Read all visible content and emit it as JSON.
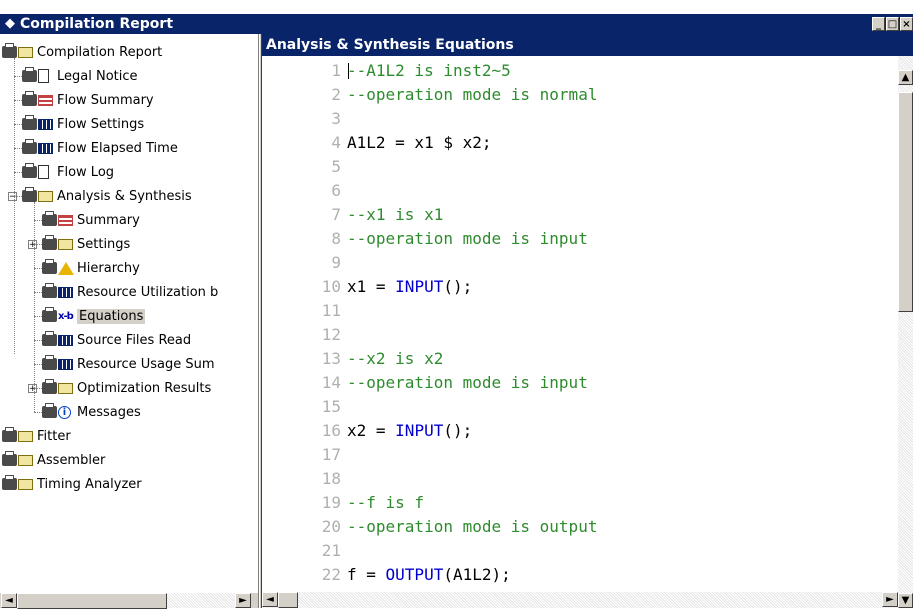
{
  "window": {
    "title": "Compilation Report",
    "buttons": {
      "minimize": "_",
      "maximize": "□",
      "close": "×"
    }
  },
  "tree": [
    {
      "id": "compilation-report",
      "label": "Compilation Report",
      "icon": "folder",
      "level": 0,
      "expander": ""
    },
    {
      "id": "legal-notice",
      "label": "Legal Notice",
      "icon": "document",
      "level": 1,
      "expander": ""
    },
    {
      "id": "flow-summary",
      "label": "Flow Summary",
      "icon": "table-red",
      "level": 1,
      "expander": ""
    },
    {
      "id": "flow-settings",
      "label": "Flow Settings",
      "icon": "table",
      "level": 1,
      "expander": ""
    },
    {
      "id": "flow-elapsed-time",
      "label": "Flow Elapsed Time",
      "icon": "table",
      "level": 1,
      "expander": ""
    },
    {
      "id": "flow-log",
      "label": "Flow Log",
      "icon": "document",
      "level": 1,
      "expander": ""
    },
    {
      "id": "analysis-synthesis",
      "label": "Analysis & Synthesis",
      "icon": "folder",
      "level": 1,
      "expander": "−"
    },
    {
      "id": "summary",
      "label": "Summary",
      "icon": "table-red",
      "level": 2,
      "expander": ""
    },
    {
      "id": "settings",
      "label": "Settings",
      "icon": "folder",
      "level": 2,
      "expander": "+"
    },
    {
      "id": "hierarchy",
      "label": "Hierarchy",
      "icon": "warning",
      "level": 2,
      "expander": ""
    },
    {
      "id": "resource-utilization",
      "label": "Resource Utilization b",
      "icon": "table",
      "level": 2,
      "expander": ""
    },
    {
      "id": "equations",
      "label": "Equations",
      "icon": "equations",
      "level": 2,
      "expander": "",
      "selected": true
    },
    {
      "id": "source-files-read",
      "label": "Source Files Read",
      "icon": "table",
      "level": 2,
      "expander": ""
    },
    {
      "id": "resource-usage-summary",
      "label": "Resource Usage Sum",
      "icon": "table",
      "level": 2,
      "expander": ""
    },
    {
      "id": "optimization-results",
      "label": "Optimization Results",
      "icon": "folder",
      "level": 2,
      "expander": "+"
    },
    {
      "id": "messages",
      "label": "Messages",
      "icon": "info",
      "level": 2,
      "expander": ""
    },
    {
      "id": "fitter",
      "label": "Fitter",
      "icon": "folder",
      "level": 0,
      "expander": "+"
    },
    {
      "id": "assembler",
      "label": "Assembler",
      "icon": "folder",
      "level": 0,
      "expander": "+"
    },
    {
      "id": "timing-analyzer",
      "label": "Timing Analyzer",
      "icon": "folder",
      "level": 0,
      "expander": "+"
    }
  ],
  "panel": {
    "title": "Analysis & Synthesis Equations",
    "lines": [
      {
        "n": "1",
        "parts": [
          {
            "t": "--A1L2 is inst2~5",
            "c": "comment"
          }
        ]
      },
      {
        "n": "2",
        "parts": [
          {
            "t": "--operation mode is normal",
            "c": "comment"
          }
        ]
      },
      {
        "n": "3",
        "parts": []
      },
      {
        "n": "4",
        "parts": [
          {
            "t": "A1L2 = x1 $ x2;",
            "c": "text"
          }
        ]
      },
      {
        "n": "5",
        "parts": []
      },
      {
        "n": "6",
        "parts": []
      },
      {
        "n": "7",
        "parts": [
          {
            "t": "--x1 is x1",
            "c": "comment"
          }
        ]
      },
      {
        "n": "8",
        "parts": [
          {
            "t": "--operation mode is input",
            "c": "comment"
          }
        ]
      },
      {
        "n": "9",
        "parts": []
      },
      {
        "n": "10",
        "parts": [
          {
            "t": "x1 = ",
            "c": "text"
          },
          {
            "t": "INPUT",
            "c": "keyword"
          },
          {
            "t": "();",
            "c": "text"
          }
        ]
      },
      {
        "n": "11",
        "parts": []
      },
      {
        "n": "12",
        "parts": []
      },
      {
        "n": "13",
        "parts": [
          {
            "t": "--x2 is x2",
            "c": "comment"
          }
        ]
      },
      {
        "n": "14",
        "parts": [
          {
            "t": "--operation mode is input",
            "c": "comment"
          }
        ]
      },
      {
        "n": "15",
        "parts": []
      },
      {
        "n": "16",
        "parts": [
          {
            "t": "x2 = ",
            "c": "text"
          },
          {
            "t": "INPUT",
            "c": "keyword"
          },
          {
            "t": "();",
            "c": "text"
          }
        ]
      },
      {
        "n": "17",
        "parts": []
      },
      {
        "n": "18",
        "parts": []
      },
      {
        "n": "19",
        "parts": [
          {
            "t": "--f is f",
            "c": "comment"
          }
        ]
      },
      {
        "n": "20",
        "parts": [
          {
            "t": "--operation mode is output",
            "c": "comment"
          }
        ]
      },
      {
        "n": "21",
        "parts": []
      },
      {
        "n": "22",
        "parts": [
          {
            "t": "f = ",
            "c": "text"
          },
          {
            "t": "OUTPUT",
            "c": "keyword"
          },
          {
            "t": "(A1L2);",
            "c": "text"
          }
        ]
      }
    ]
  },
  "scroll": {
    "left": "◄",
    "right": "►",
    "up": "▲",
    "down": "▼"
  }
}
